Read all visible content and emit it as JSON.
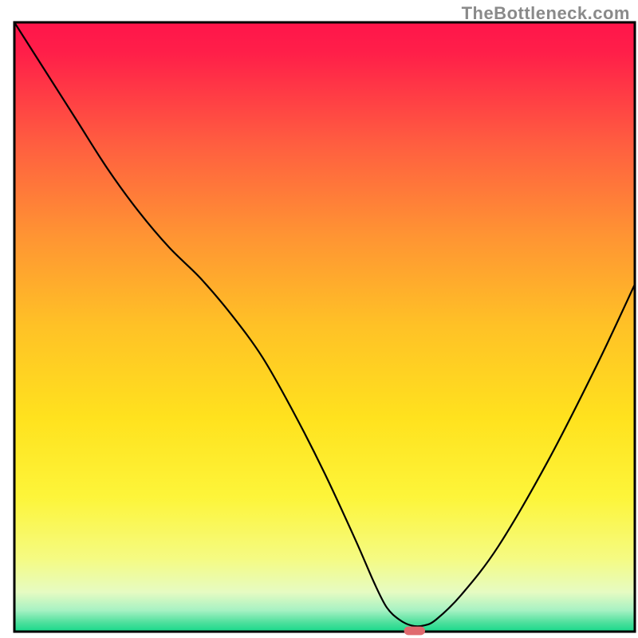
{
  "watermark": "TheBottleneck.com",
  "chart_data": {
    "type": "line",
    "title": "",
    "xlabel": "",
    "ylabel": "",
    "xlim": [
      0,
      100
    ],
    "ylim": [
      0,
      100
    ],
    "background_gradient": {
      "direction": "vertical",
      "stops": [
        {
          "pos": 0.0,
          "color": "#ff154a"
        },
        {
          "pos": 0.05,
          "color": "#ff1f49"
        },
        {
          "pos": 0.2,
          "color": "#ff5e40"
        },
        {
          "pos": 0.35,
          "color": "#ff9433"
        },
        {
          "pos": 0.5,
          "color": "#ffc226"
        },
        {
          "pos": 0.65,
          "color": "#ffe21e"
        },
        {
          "pos": 0.78,
          "color": "#fdf53a"
        },
        {
          "pos": 0.88,
          "color": "#f5fb82"
        },
        {
          "pos": 0.935,
          "color": "#e6fbc2"
        },
        {
          "pos": 0.965,
          "color": "#a7f2c3"
        },
        {
          "pos": 0.985,
          "color": "#4fe09d"
        },
        {
          "pos": 1.0,
          "color": "#17d88a"
        }
      ]
    },
    "axis_frame": true,
    "series": [
      {
        "name": "curve",
        "stroke": "#000000",
        "x": [
          0,
          5,
          10,
          15,
          20,
          25,
          30,
          35,
          40,
          45,
          50,
          55,
          58,
          60,
          62,
          64,
          66,
          68,
          72,
          78,
          86,
          94,
          100
        ],
        "y": [
          100,
          92,
          84,
          76,
          69,
          63,
          58,
          52,
          45,
          36,
          26,
          15,
          8,
          4,
          2,
          1,
          1,
          2,
          6,
          14,
          28,
          44,
          57
        ]
      }
    ],
    "marker": {
      "name": "optimum-marker",
      "x": 64.5,
      "y": 0,
      "color": "#e06a6f",
      "shape": "pill",
      "width": 3.4,
      "height": 1.4
    }
  }
}
